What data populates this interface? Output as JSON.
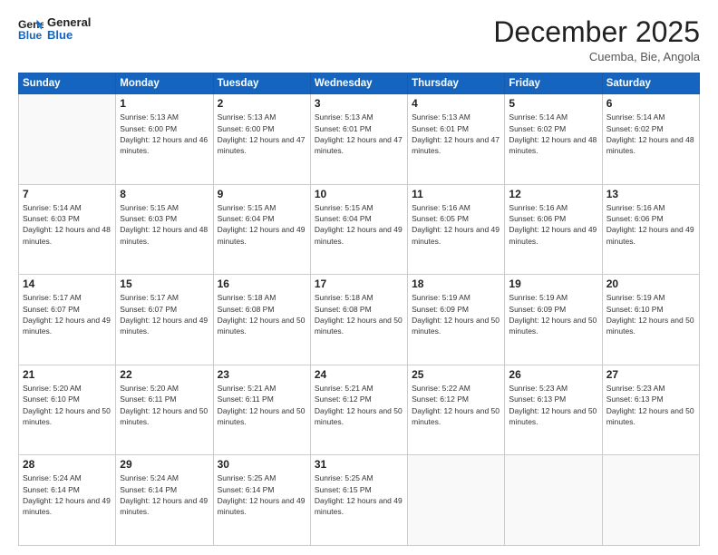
{
  "header": {
    "logo_line1": "General",
    "logo_line2": "Blue",
    "month": "December 2025",
    "location": "Cuemba, Bie, Angola"
  },
  "weekdays": [
    "Sunday",
    "Monday",
    "Tuesday",
    "Wednesday",
    "Thursday",
    "Friday",
    "Saturday"
  ],
  "weeks": [
    [
      {
        "day": "",
        "sunrise": "",
        "sunset": "",
        "daylight": ""
      },
      {
        "day": "1",
        "sunrise": "Sunrise: 5:13 AM",
        "sunset": "Sunset: 6:00 PM",
        "daylight": "Daylight: 12 hours and 46 minutes."
      },
      {
        "day": "2",
        "sunrise": "Sunrise: 5:13 AM",
        "sunset": "Sunset: 6:00 PM",
        "daylight": "Daylight: 12 hours and 47 minutes."
      },
      {
        "day": "3",
        "sunrise": "Sunrise: 5:13 AM",
        "sunset": "Sunset: 6:01 PM",
        "daylight": "Daylight: 12 hours and 47 minutes."
      },
      {
        "day": "4",
        "sunrise": "Sunrise: 5:13 AM",
        "sunset": "Sunset: 6:01 PM",
        "daylight": "Daylight: 12 hours and 47 minutes."
      },
      {
        "day": "5",
        "sunrise": "Sunrise: 5:14 AM",
        "sunset": "Sunset: 6:02 PM",
        "daylight": "Daylight: 12 hours and 48 minutes."
      },
      {
        "day": "6",
        "sunrise": "Sunrise: 5:14 AM",
        "sunset": "Sunset: 6:02 PM",
        "daylight": "Daylight: 12 hours and 48 minutes."
      }
    ],
    [
      {
        "day": "7",
        "sunrise": "Sunrise: 5:14 AM",
        "sunset": "Sunset: 6:03 PM",
        "daylight": "Daylight: 12 hours and 48 minutes."
      },
      {
        "day": "8",
        "sunrise": "Sunrise: 5:15 AM",
        "sunset": "Sunset: 6:03 PM",
        "daylight": "Daylight: 12 hours and 48 minutes."
      },
      {
        "day": "9",
        "sunrise": "Sunrise: 5:15 AM",
        "sunset": "Sunset: 6:04 PM",
        "daylight": "Daylight: 12 hours and 49 minutes."
      },
      {
        "day": "10",
        "sunrise": "Sunrise: 5:15 AM",
        "sunset": "Sunset: 6:04 PM",
        "daylight": "Daylight: 12 hours and 49 minutes."
      },
      {
        "day": "11",
        "sunrise": "Sunrise: 5:16 AM",
        "sunset": "Sunset: 6:05 PM",
        "daylight": "Daylight: 12 hours and 49 minutes."
      },
      {
        "day": "12",
        "sunrise": "Sunrise: 5:16 AM",
        "sunset": "Sunset: 6:06 PM",
        "daylight": "Daylight: 12 hours and 49 minutes."
      },
      {
        "day": "13",
        "sunrise": "Sunrise: 5:16 AM",
        "sunset": "Sunset: 6:06 PM",
        "daylight": "Daylight: 12 hours and 49 minutes."
      }
    ],
    [
      {
        "day": "14",
        "sunrise": "Sunrise: 5:17 AM",
        "sunset": "Sunset: 6:07 PM",
        "daylight": "Daylight: 12 hours and 49 minutes."
      },
      {
        "day": "15",
        "sunrise": "Sunrise: 5:17 AM",
        "sunset": "Sunset: 6:07 PM",
        "daylight": "Daylight: 12 hours and 49 minutes."
      },
      {
        "day": "16",
        "sunrise": "Sunrise: 5:18 AM",
        "sunset": "Sunset: 6:08 PM",
        "daylight": "Daylight: 12 hours and 50 minutes."
      },
      {
        "day": "17",
        "sunrise": "Sunrise: 5:18 AM",
        "sunset": "Sunset: 6:08 PM",
        "daylight": "Daylight: 12 hours and 50 minutes."
      },
      {
        "day": "18",
        "sunrise": "Sunrise: 5:19 AM",
        "sunset": "Sunset: 6:09 PM",
        "daylight": "Daylight: 12 hours and 50 minutes."
      },
      {
        "day": "19",
        "sunrise": "Sunrise: 5:19 AM",
        "sunset": "Sunset: 6:09 PM",
        "daylight": "Daylight: 12 hours and 50 minutes."
      },
      {
        "day": "20",
        "sunrise": "Sunrise: 5:19 AM",
        "sunset": "Sunset: 6:10 PM",
        "daylight": "Daylight: 12 hours and 50 minutes."
      }
    ],
    [
      {
        "day": "21",
        "sunrise": "Sunrise: 5:20 AM",
        "sunset": "Sunset: 6:10 PM",
        "daylight": "Daylight: 12 hours and 50 minutes."
      },
      {
        "day": "22",
        "sunrise": "Sunrise: 5:20 AM",
        "sunset": "Sunset: 6:11 PM",
        "daylight": "Daylight: 12 hours and 50 minutes."
      },
      {
        "day": "23",
        "sunrise": "Sunrise: 5:21 AM",
        "sunset": "Sunset: 6:11 PM",
        "daylight": "Daylight: 12 hours and 50 minutes."
      },
      {
        "day": "24",
        "sunrise": "Sunrise: 5:21 AM",
        "sunset": "Sunset: 6:12 PM",
        "daylight": "Daylight: 12 hours and 50 minutes."
      },
      {
        "day": "25",
        "sunrise": "Sunrise: 5:22 AM",
        "sunset": "Sunset: 6:12 PM",
        "daylight": "Daylight: 12 hours and 50 minutes."
      },
      {
        "day": "26",
        "sunrise": "Sunrise: 5:23 AM",
        "sunset": "Sunset: 6:13 PM",
        "daylight": "Daylight: 12 hours and 50 minutes."
      },
      {
        "day": "27",
        "sunrise": "Sunrise: 5:23 AM",
        "sunset": "Sunset: 6:13 PM",
        "daylight": "Daylight: 12 hours and 50 minutes."
      }
    ],
    [
      {
        "day": "28",
        "sunrise": "Sunrise: 5:24 AM",
        "sunset": "Sunset: 6:14 PM",
        "daylight": "Daylight: 12 hours and 49 minutes."
      },
      {
        "day": "29",
        "sunrise": "Sunrise: 5:24 AM",
        "sunset": "Sunset: 6:14 PM",
        "daylight": "Daylight: 12 hours and 49 minutes."
      },
      {
        "day": "30",
        "sunrise": "Sunrise: 5:25 AM",
        "sunset": "Sunset: 6:14 PM",
        "daylight": "Daylight: 12 hours and 49 minutes."
      },
      {
        "day": "31",
        "sunrise": "Sunrise: 5:25 AM",
        "sunset": "Sunset: 6:15 PM",
        "daylight": "Daylight: 12 hours and 49 minutes."
      },
      {
        "day": "",
        "sunrise": "",
        "sunset": "",
        "daylight": ""
      },
      {
        "day": "",
        "sunrise": "",
        "sunset": "",
        "daylight": ""
      },
      {
        "day": "",
        "sunrise": "",
        "sunset": "",
        "daylight": ""
      }
    ]
  ]
}
